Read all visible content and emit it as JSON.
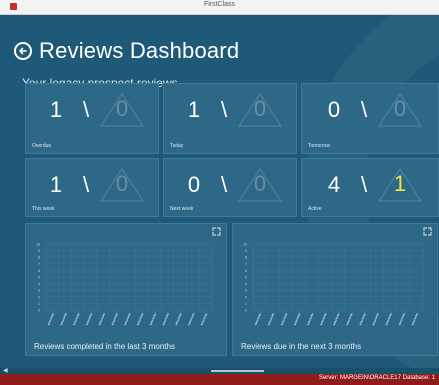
{
  "window": {
    "title": "FirstClass"
  },
  "header": {
    "title": "Reviews Dashboard"
  },
  "subtitle": "Your legacy prospect reviews",
  "tiles": [
    {
      "label": "Overdue",
      "left": "1",
      "right": "0",
      "highlight": false
    },
    {
      "label": "Today",
      "left": "1",
      "right": "0",
      "highlight": false
    },
    {
      "label": "Tomorrow",
      "left": "0",
      "right": "0",
      "highlight": false
    },
    {
      "label": "This week",
      "left": "1",
      "right": "0",
      "highlight": false
    },
    {
      "label": "Next week",
      "left": "0",
      "right": "0",
      "highlight": false
    },
    {
      "label": "Active",
      "left": "4",
      "right": "1",
      "highlight": true
    }
  ],
  "charts": [
    {
      "caption": "Reviews completed in the last 3 months",
      "ticks": [
        "10",
        "9",
        "8",
        "7",
        "6",
        "5",
        "4",
        "3",
        "2",
        "1",
        "0"
      ]
    },
    {
      "caption": "Reviews due in the next 3 months",
      "ticks": [
        "10",
        "9",
        "8",
        "7",
        "6",
        "5",
        "4",
        "3",
        "2",
        "1",
        "0"
      ]
    }
  ],
  "status": {
    "text": "Server: MARGEIN\\ORACLE17  Database: 1"
  }
}
